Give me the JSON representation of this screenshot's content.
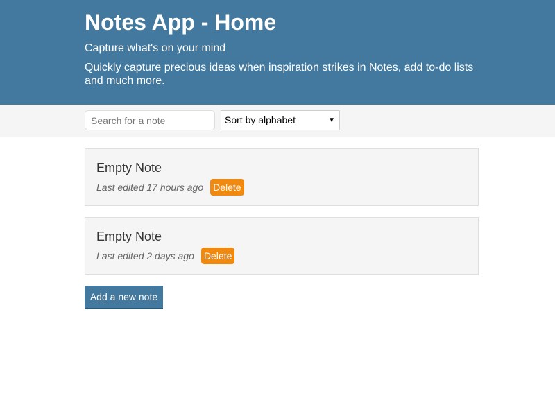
{
  "header": {
    "title": "Notes App - Home",
    "subtitle": "Capture what's on your mind",
    "description": "Quickly capture precious ideas when inspiration strikes in Notes, add to-do lists and much more."
  },
  "toolbar": {
    "search_placeholder": "Search for a note",
    "search_value": "",
    "sort_selected": "Sort by alphabet"
  },
  "notes": [
    {
      "title": "Empty Note",
      "edited": "Last edited 17 hours ago",
      "delete_label": "Delete"
    },
    {
      "title": "Empty Note",
      "edited": "Last edited 2 days ago",
      "delete_label": "Delete"
    }
  ],
  "actions": {
    "add_note_label": "Add a new note"
  },
  "colors": {
    "header_bg": "#43799e",
    "toolbar_bg": "#f5f5f5",
    "delete_button": "#f0890f",
    "primary_button": "#43799e"
  }
}
